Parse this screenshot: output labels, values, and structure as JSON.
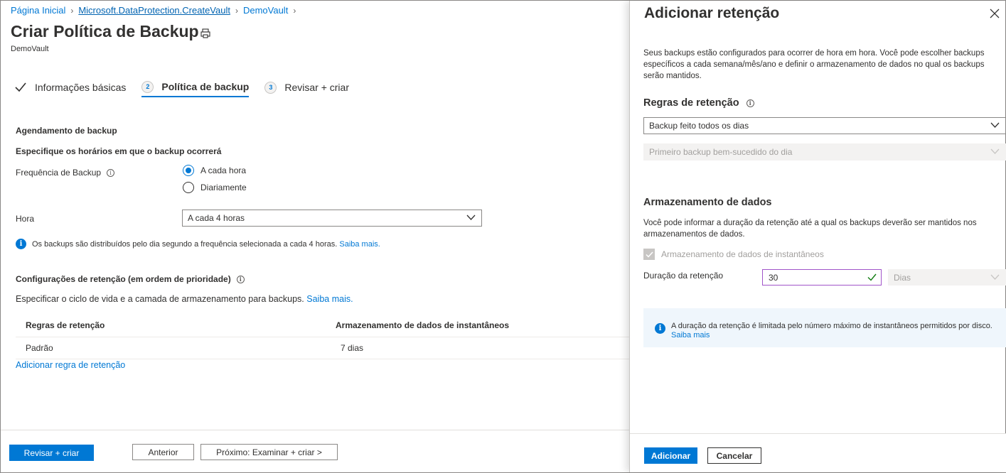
{
  "breadcrumb": {
    "home": "Página Inicial",
    "create_vault": "Microsoft.DataProtection.CreateVault",
    "vault": "DemoVault"
  },
  "page": {
    "title": "Criar Política de Backup",
    "subtitle": "DemoVault"
  },
  "steps": [
    {
      "number": "",
      "label": "Informações básicas",
      "state": "done"
    },
    {
      "number": "2",
      "label": "Política de backup",
      "state": "active"
    },
    {
      "number": "3",
      "label": "Revisar + criar",
      "state": "pending"
    }
  ],
  "schedule": {
    "section_title": "Agendamento de backup",
    "instruction": "Especifique os horários em que o backup ocorrerá",
    "frequency_label": "Frequência de Backup",
    "frequency_options": [
      "A cada hora",
      "Diariamente"
    ],
    "frequency_selected": "A cada hora",
    "hour_label": "Hora",
    "hour_value": "A cada 4 horas",
    "info_text": "Os backups são distribuídos pelo dia segundo a frequência selecionada a cada 4 horas.",
    "info_link": "Saiba mais."
  },
  "retention": {
    "section_title": "Configurações de retenção (em ordem de prioridade)",
    "description": "Especificar o ciclo de vida e a camada de armazenamento para backups.",
    "description_link": "Saiba mais.",
    "table_headers": [
      "Regras de retenção",
      "Armazenamento de dados de instantâneos"
    ],
    "rows": [
      {
        "rule": "Padrão",
        "snapshot": "7 dias"
      }
    ],
    "add_link": "Adicionar regra de retenção"
  },
  "footer": {
    "review_create": "Revisar + criar",
    "previous": "Anterior",
    "next": "Próximo: Examinar + criar >"
  },
  "panel": {
    "title": "Adicionar retenção",
    "description": "Seus backups estão configurados para ocorrer de hora em hora. Você pode escolher backups específicos a cada semana/mês/ano e definir o armazenamento de dados no qual os backups serão mantidos.",
    "rules_heading": "Regras de retenção",
    "rules_dropdown": "Backup feito todos os dias",
    "rules_dropdown_disabled": "Primeiro backup bem-sucedido do dia",
    "storage_heading": "Armazenamento de dados",
    "storage_description": "Você pode informar a duração da retenção até a qual os backups deverão ser mantidos nos armazenamentos de dados.",
    "snapshot_checkbox": "Armazenamento de dados de instantâneos",
    "duration_label": "Duração da retenção",
    "duration_value": "30",
    "duration_unit": "Dias",
    "info_text": "A duração da retenção é limitada pelo número máximo de instantâneos permitidos por disco.",
    "info_link": "Saiba mais",
    "add_button": "Adicionar",
    "cancel_button": "Cancelar"
  },
  "colors": {
    "accent": "#0078d4",
    "input_focus": "#a154c9",
    "success": "#107c10",
    "info_bg": "#eff6fc"
  }
}
